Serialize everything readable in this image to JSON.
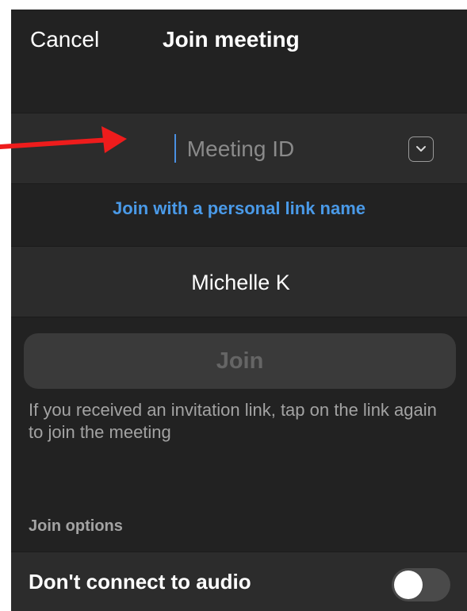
{
  "nav": {
    "cancel_label": "Cancel",
    "title": "Join meeting"
  },
  "meeting_id": {
    "placeholder": "Meeting ID",
    "value": "",
    "dropdown_icon": "chevron-down-icon"
  },
  "personal_link": {
    "label": "Join with a personal link name"
  },
  "name_field": {
    "value": "Michelle K"
  },
  "join_button": {
    "label": "Join",
    "enabled": false
  },
  "hint": {
    "text": "If you received an invitation link, tap on the link again to join the meeting"
  },
  "join_options": {
    "section_label": "Join options",
    "items": [
      {
        "label": "Don't connect to audio",
        "enabled": false
      }
    ]
  },
  "colors": {
    "background": "#222222",
    "row": "#2c2c2c",
    "link": "#4a9ae8",
    "annotation_arrow": "#ee1c1c"
  }
}
